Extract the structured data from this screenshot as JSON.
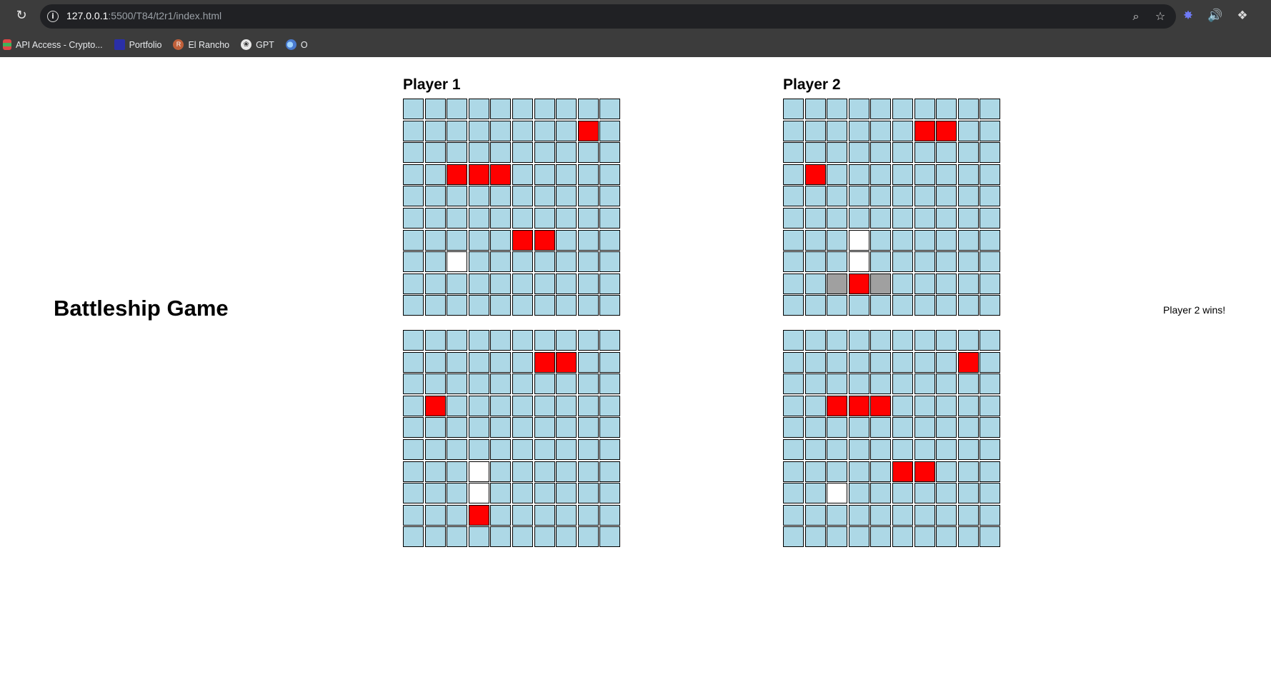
{
  "browser": {
    "url_host": "127.0.0.1",
    "url_path": ":5500/T84/t2r1/index.html",
    "bookmarks": [
      {
        "label": "API Access - Crypto...",
        "icon": "api-access-icon"
      },
      {
        "label": "Portfolio",
        "icon": "portfolio-icon"
      },
      {
        "label": "El Rancho",
        "icon": "el-rancho-icon"
      },
      {
        "label": "GPT",
        "icon": "gpt-icon"
      },
      {
        "label": "O",
        "icon": "o-icon"
      }
    ]
  },
  "page": {
    "title": "Battleship Game",
    "status": "Player 2 wins!"
  },
  "colors": {
    "water": "#add8e6",
    "hit": "#ff0000",
    "miss": "#ffffff",
    "ship": "#a0a0a0"
  },
  "players": [
    {
      "name": "Player 1",
      "boards": [
        {
          "label": "top",
          "rows": [
            "..........",
            "........H.",
            "..........",
            "..HHH.....",
            "..........",
            "..........",
            ".....HH...",
            "..M.......",
            "..........",
            ".........."
          ]
        },
        {
          "label": "bottom",
          "rows": [
            "..........",
            "......HH..",
            "..........",
            ".H........",
            "..........",
            "..........",
            "...M......",
            "...M......",
            "...H......",
            ".........."
          ]
        }
      ]
    },
    {
      "name": "Player 2",
      "boards": [
        {
          "label": "top",
          "rows": [
            "..........",
            "......HH..",
            "..........",
            ".H........",
            "..........",
            "..........",
            "...M......",
            "...M......",
            "..SHS.....",
            ".........."
          ]
        },
        {
          "label": "bottom",
          "rows": [
            "..........",
            "........H.",
            "..........",
            "..HHH.....",
            "..........",
            "..........",
            ".....HH...",
            "..M.......",
            "..........",
            ".........."
          ]
        }
      ]
    }
  ]
}
